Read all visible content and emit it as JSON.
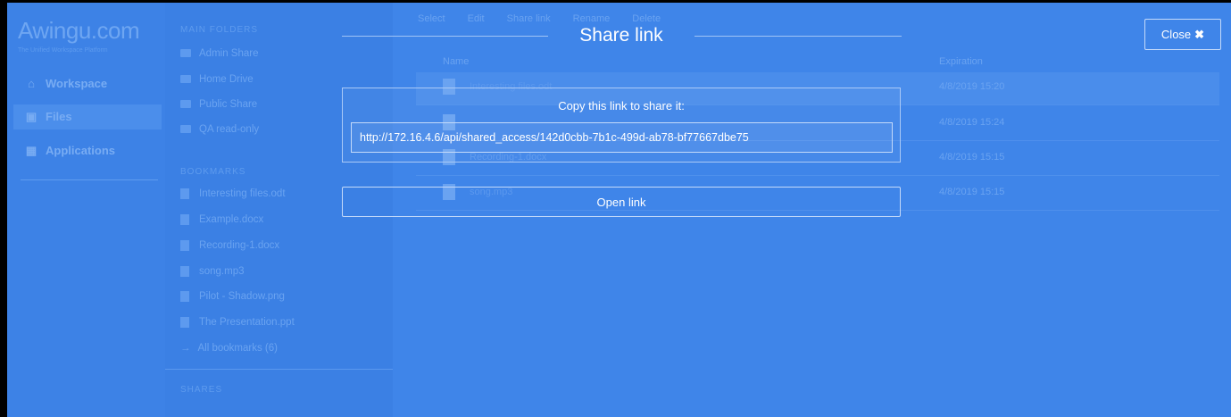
{
  "app": {
    "logo": "Awingu.com",
    "logo_tagline": "The Unified Workspace Platform"
  },
  "sidebar": {
    "items": [
      {
        "label": "Workspace",
        "icon": "home-icon"
      },
      {
        "label": "Files",
        "icon": "folder-open-icon",
        "active": true
      },
      {
        "label": "Applications",
        "icon": "grid-icon"
      }
    ]
  },
  "folders": {
    "main_heading": "MAIN FOLDERS",
    "main": [
      "Admin Share",
      "Home Drive",
      "Public Share",
      "QA read-only"
    ],
    "bookmarks_heading": "BOOKMARKS",
    "bookmarks": [
      "Interesting files.odt",
      "Example.docx",
      "Recording-1.docx",
      "song.mp3",
      "Pilot - Shadow.png",
      "The Presentation.ppt",
      "All bookmarks (6)"
    ],
    "shares_heading": "SHARES"
  },
  "content": {
    "toolbar": [
      "Select",
      "Edit",
      "Share link",
      "Rename",
      "Delete"
    ],
    "col_name": "Name",
    "col_expiration": "Expiration",
    "rows": [
      {
        "name": "Interesting files.odt",
        "date": "4/8/2019 15:20"
      },
      {
        "name": "",
        "date": "4/8/2019 15:24"
      },
      {
        "name": "Recording-1.docx",
        "date": "4/8/2019 15:15"
      },
      {
        "name": "song.mp3",
        "date": "4/8/2019 15:15"
      }
    ]
  },
  "modal": {
    "title": "Share link",
    "copy_label": "Copy this link to share it:",
    "link_value": "http://172.16.4.6/api/shared_access/142d0cbb-7b1c-499d-ab78-bf77667dbe75",
    "open_button": "Open link",
    "close_button": "Close"
  },
  "colors": {
    "overlay": "#3f86ea",
    "text": "#ffffff",
    "border": "#c4dafa"
  }
}
